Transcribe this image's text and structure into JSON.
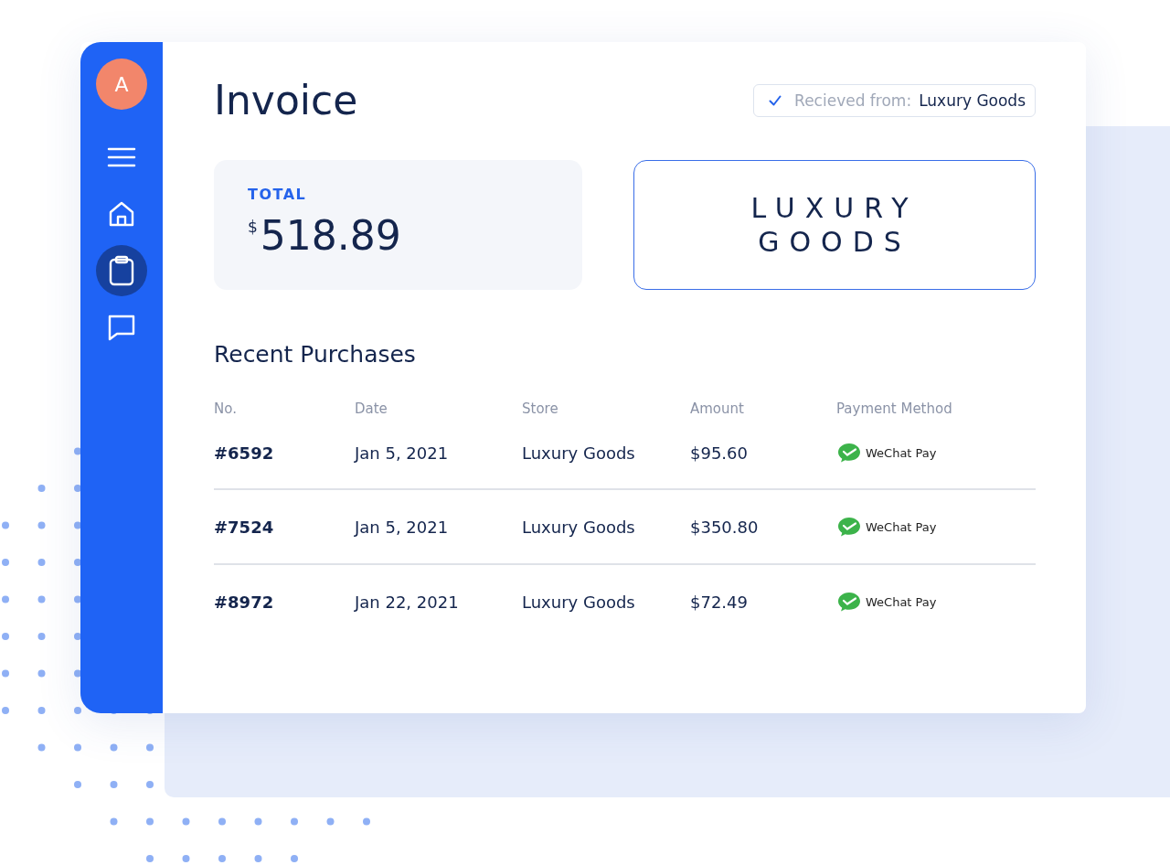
{
  "sidebar": {
    "avatar": "A",
    "items": [
      {
        "kind": "menu",
        "selected": false
      },
      {
        "kind": "home",
        "selected": false
      },
      {
        "kind": "clipboard",
        "selected": true
      },
      {
        "kind": "chat",
        "selected": false
      }
    ]
  },
  "invoice": {
    "title": "Invoice",
    "received": {
      "label": "Recieved from:",
      "value": "Luxury Goods"
    },
    "total": {
      "label": "TOTAL",
      "currency": "$",
      "amount": "518.89"
    },
    "logo": [
      "LUXURY",
      "GOODS"
    ]
  },
  "purchases": {
    "title": "Recent Purchases",
    "columns": [
      "No.",
      "Date",
      "Store",
      "Amount",
      "Payment Method"
    ],
    "rows": [
      {
        "no": "#6592",
        "date": "Jan 5, 2021",
        "store": "Luxury Goods",
        "amount": "$95.60",
        "payment": "WeChat Pay"
      },
      {
        "no": "#7524",
        "date": "Jan 5, 2021",
        "store": "Luxury Goods",
        "amount": "$350.80",
        "payment": "WeChat Pay"
      },
      {
        "no": "#8972",
        "date": "Jan 22, 2021",
        "store": "Luxury Goods",
        "amount": "$72.49",
        "payment": "WeChat Pay"
      }
    ]
  }
}
